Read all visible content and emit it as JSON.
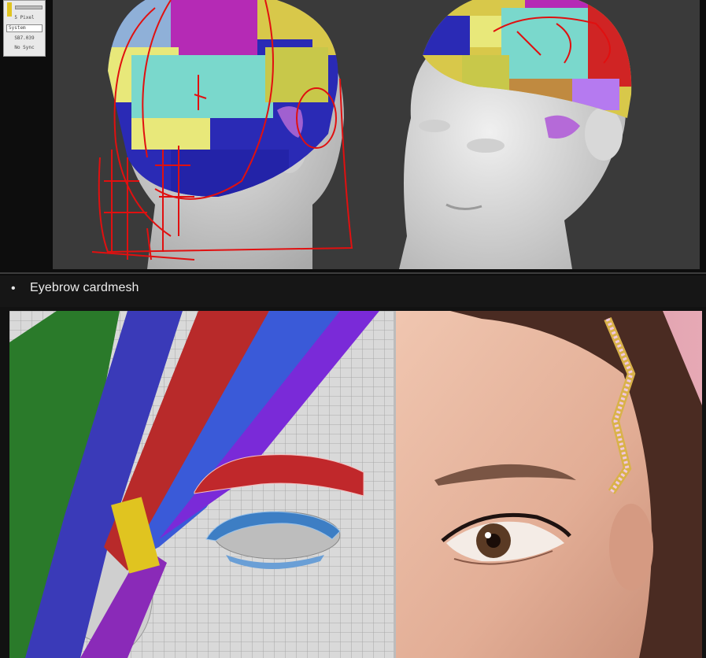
{
  "top_panel": {
    "pixel_label": "5 Pixel",
    "mode_select": "System",
    "value_readout": "SB7.039",
    "status_label": "No Sync"
  },
  "section": {
    "bullet": "•",
    "title": "Eyebrow cardmesh"
  },
  "colors": {
    "background": "#121212",
    "viewport": "#3a3a3a",
    "annotation": "#e01010",
    "eyebrow_mesh": "#c0282b",
    "eyelash_mesh": "#3d7ec4"
  },
  "icons": [
    "bullet-dot-icon"
  ]
}
